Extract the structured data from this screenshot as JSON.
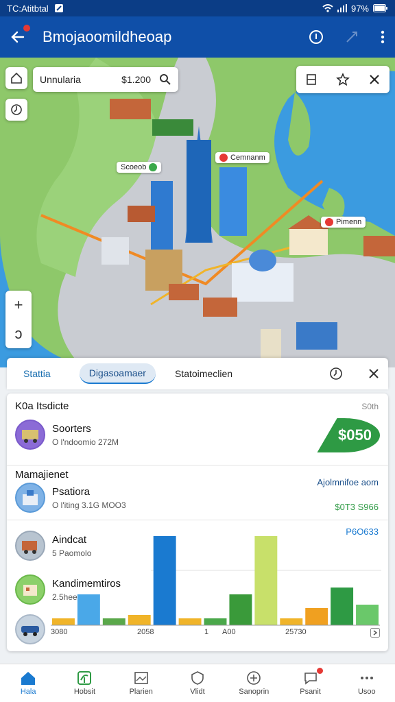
{
  "status_bar": {
    "left": "TC:Atitbtal",
    "battery": "97%"
  },
  "app_bar": {
    "title": "Bmojaoomildheoap"
  },
  "map": {
    "search_value": "Unnularia",
    "search_price": "$1.200",
    "pins": [
      {
        "label": "Scoeob",
        "color": "#3aa84a"
      },
      {
        "label": "Cemnanm",
        "color": "#e53935"
      },
      {
        "label": "Pimenn",
        "color": "#e53935"
      }
    ],
    "zoom_in": "+",
    "zoom_out": "ↄ"
  },
  "tabs": {
    "items": [
      "Stattia",
      "Digasoamaer",
      "Statoimeclien"
    ],
    "active_index": 1
  },
  "panel": {
    "section1_title": "K0a Itsdicte",
    "section1_meta": "S0th",
    "badge_value": "$050",
    "items": [
      {
        "name": "Soorters",
        "sub": "O l'ndoomio 272M"
      },
      {
        "name": "Psatiora",
        "sub": "O l'iting 3.1G MOO3"
      },
      {
        "name": "Aindcat",
        "sub": "5 Paomolo"
      },
      {
        "name": "Kandimemtiros",
        "sub": "2.5heet"
      }
    ],
    "section2_title": "Mamajienet",
    "section2_right": "Ajolmnifoe aom",
    "section2_value": "$0T3 S966",
    "chart_value_label": "P6O633",
    "colors": {
      "green": "#2e9a44",
      "blue": "#1a7ad0"
    }
  },
  "chart_data": {
    "type": "bar",
    "x_tick_labels": [
      "3080",
      "2058",
      "1",
      "A00",
      "25730"
    ],
    "series": [
      {
        "values": [
          0.1,
          0.45,
          0.1,
          0.15,
          1.3,
          0.1,
          0.1,
          0.45,
          1.3,
          0.1,
          0.25,
          0.55,
          0.3
        ]
      }
    ]
  },
  "bottom_nav": {
    "items": [
      "Hala",
      "Hobsit",
      "Plarien",
      "Vlidt",
      "Sanoprin",
      "Psanit",
      "Usoo"
    ],
    "active_index": 0
  }
}
